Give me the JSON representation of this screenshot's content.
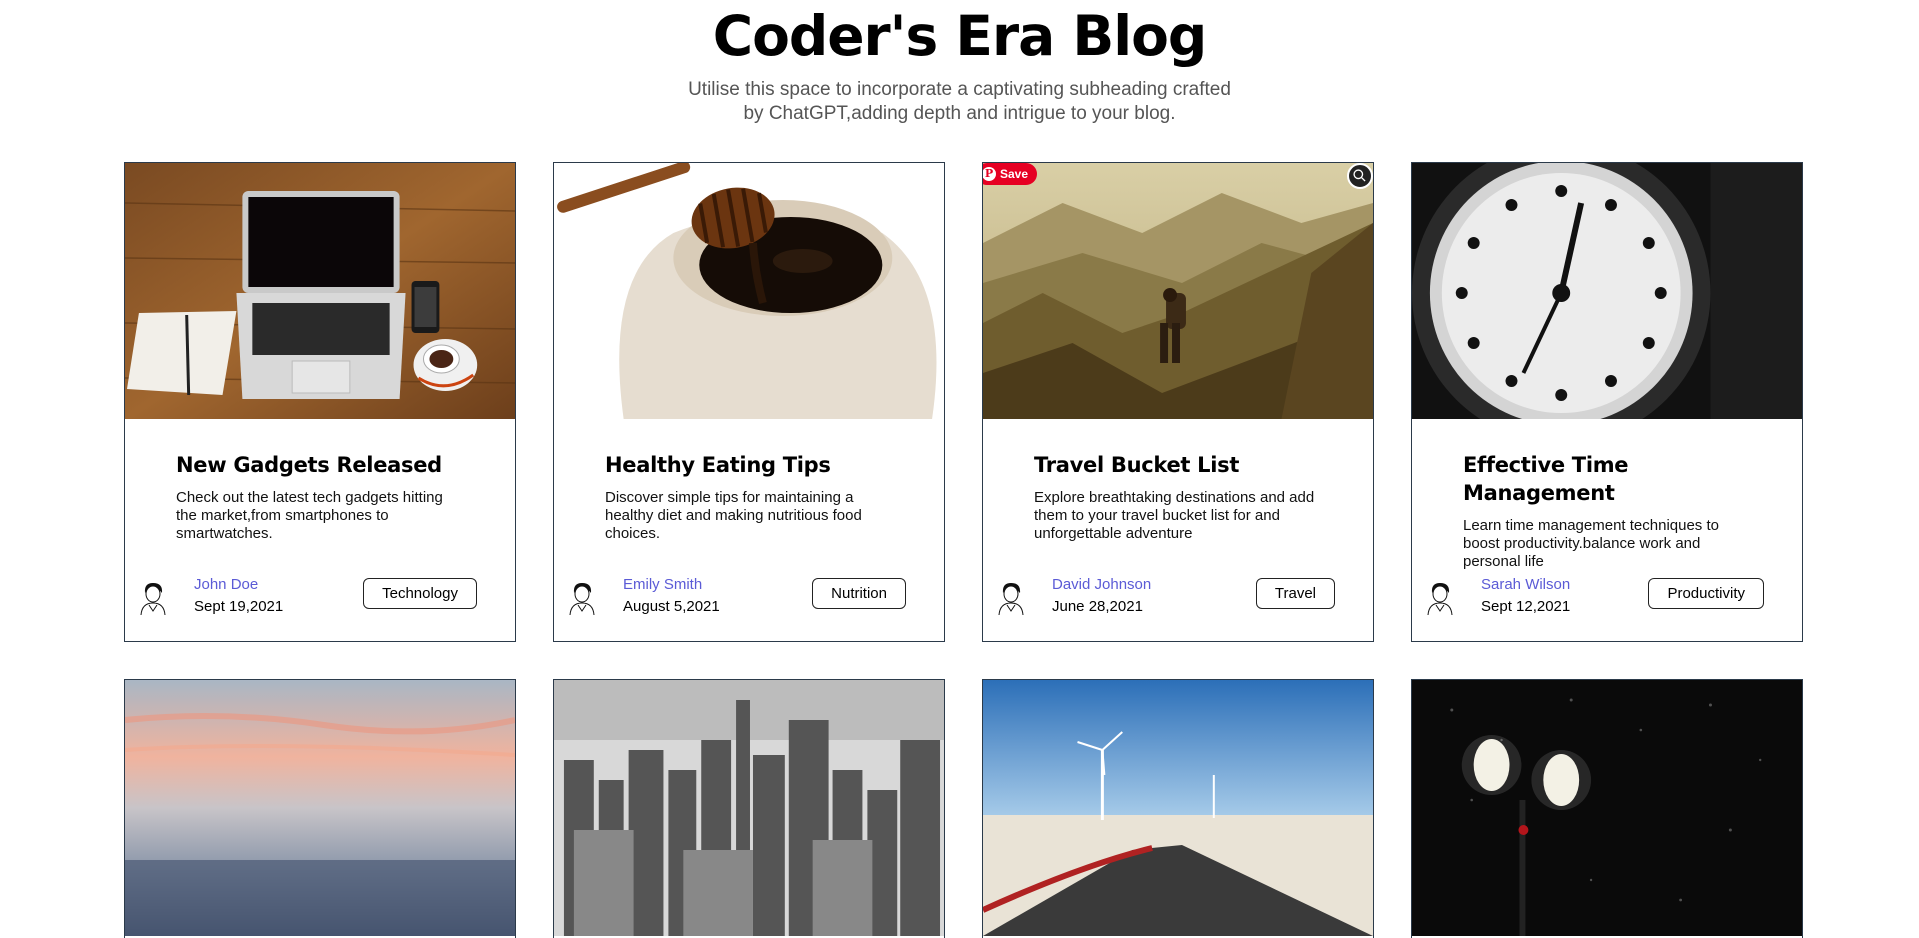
{
  "header": {
    "title": "Coder's Era Blog",
    "subtitle": "Utilise this space to incorporate a captivating subheading crafted by ChatGPT,adding depth and intrigue to your blog."
  },
  "overlays": {
    "pin_save_label": "Save",
    "pin_p_glyph": "P"
  },
  "cards": [
    {
      "image": "laptop-desk-photo",
      "title": "New Gadgets Released",
      "description": "Check out the latest tech gadgets hitting the market,from smartphones to smartwatches.",
      "author": "John Doe",
      "date": "Sept 19,2021",
      "category": "Technology"
    },
    {
      "image": "honey-pot-photo",
      "title": "Healthy Eating Tips",
      "description": "Discover simple tips for maintaining a healthy diet and making nutritious food choices.",
      "author": "Emily Smith",
      "date": "August 5,2021",
      "category": "Nutrition"
    },
    {
      "image": "mountain-hiker-photo",
      "title": "Travel Bucket List",
      "description": "Explore breathtaking destinations and add them to your travel bucket list for and unforgettable adventure",
      "author": "David Johnson",
      "date": "June 28,2021",
      "category": "Travel"
    },
    {
      "image": "clock-photo",
      "title": "Effective Time Management",
      "description": "Learn time management techniques to boost productivity.balance work and personal life",
      "author": "Sarah Wilson",
      "date": "Sept 12,2021",
      "category": "Productivity"
    },
    {
      "image": "sunset-sea-photo"
    },
    {
      "image": "city-skyline-photo"
    },
    {
      "image": "road-wind-turbines-photo"
    },
    {
      "image": "street-lamp-night-photo"
    }
  ],
  "colors": {
    "author_link": "#5b5bd6",
    "card_border": "#2b3a4a",
    "pinterest_red": "#e60023"
  }
}
